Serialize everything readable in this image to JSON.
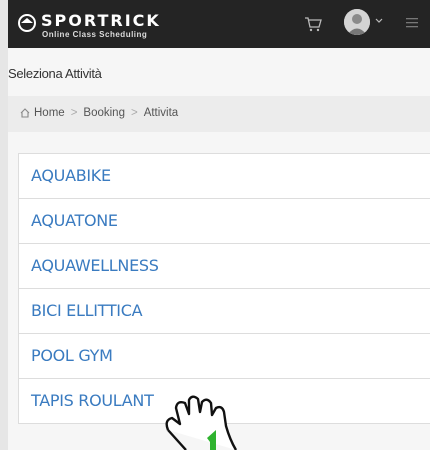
{
  "header": {
    "brand_name": "SPORTRICK",
    "brand_tagline": "Online Class Scheduling"
  },
  "page": {
    "title": "Seleziona Attività"
  },
  "breadcrumb": {
    "items": [
      "Home",
      "Booking",
      "Attivita"
    ],
    "separator": ">"
  },
  "activities": [
    "AQUABIKE",
    "AQUATONE",
    "AQUAWELLNESS",
    "BICI ELLITTICA",
    "POOL GYM",
    "TAPIS ROULANT"
  ],
  "icons": {
    "logo": "sportrick-logo-icon",
    "cart": "cart-icon",
    "avatar": "user-avatar",
    "dropdown": "chevron-down-icon",
    "menu": "hamburger-menu-icon",
    "home": "home-icon",
    "pointer": "tap-hand-icon"
  },
  "colors": {
    "topbar": "#242424",
    "link": "#3a7bc0",
    "hand_arrow": "#2fb32f"
  }
}
